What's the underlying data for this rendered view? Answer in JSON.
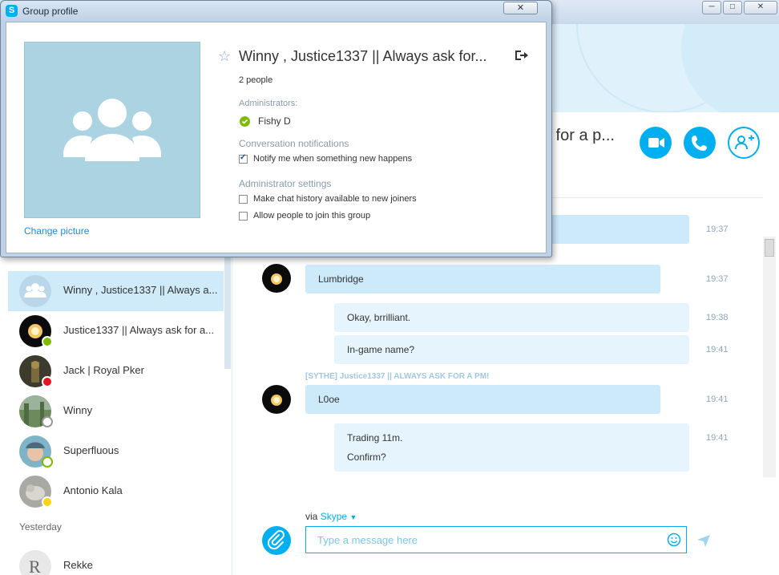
{
  "dialog": {
    "title": "Group profile",
    "close_glyph": "✕",
    "change_picture": "Change picture",
    "group_name": "Winny , Justice1337 || Always ask for...",
    "people_count": "2 people",
    "administrators_label": "Administrators:",
    "administrator_name": "Fishy D",
    "notifications_label": "Conversation notifications",
    "notify_option": {
      "label": "Notify me when something new happens",
      "checked": true
    },
    "admin_settings_label": "Administrator settings",
    "history_option": {
      "label": "Make chat history available to new joiners",
      "checked": false
    },
    "join_option": {
      "label": "Allow people to join this group",
      "checked": false
    }
  },
  "header": {
    "title_partial": "k for a p..."
  },
  "sidebar": {
    "contacts": [
      {
        "name": "Winny , Justice1337 || Always a...",
        "status": "group",
        "active": true
      },
      {
        "name": "Justice1337 || Always ask for a...",
        "status": "online",
        "active": false
      },
      {
        "name": "Jack | Royal Pker",
        "status": "busy",
        "active": false
      },
      {
        "name": "Winny",
        "status": "unknown",
        "active": false
      },
      {
        "name": "Superfluous",
        "status": "offline",
        "active": false
      },
      {
        "name": "Antonio Kala",
        "status": "away",
        "active": false
      }
    ],
    "yesterday_label": "Yesterday",
    "yesterday_contact": "Rekke"
  },
  "chat": {
    "messages": [
      {
        "text": "",
        "time": "19:37"
      },
      {
        "text": "Lumbridge",
        "time": "19:37"
      },
      {
        "text": "Okay, brrilliant.",
        "time": "19:38"
      },
      {
        "text": "In-game name?",
        "time": "19:41"
      },
      {
        "text": "L0oe",
        "time": "19:41"
      },
      {
        "text_line1": "Trading 11m.",
        "text_line2": "Confirm?",
        "time": "19:41"
      }
    ],
    "sender_label": "[SYTHE] Justice1337 || ALWAYS ASK FOR A PM!"
  },
  "composer": {
    "via_prefix": "via",
    "via_service": "Skype",
    "placeholder": "Type a message here"
  },
  "colors": {
    "accent": "#00aff0",
    "bubble_incoming": "#cdeafb",
    "bubble_outgoing": "#e6f5fd",
    "online": "#7fba00",
    "busy": "#e81123",
    "away": "#fcd116"
  }
}
